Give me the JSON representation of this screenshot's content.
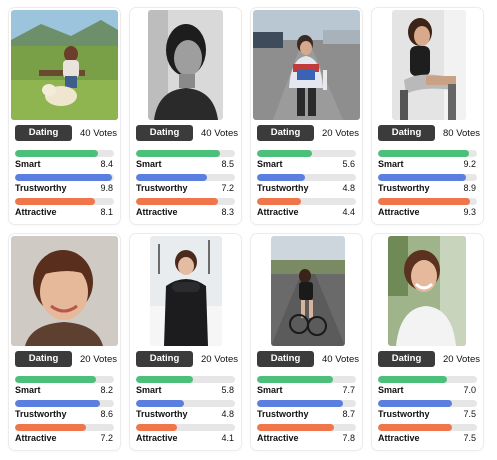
{
  "colors": {
    "smart": "#4cc07a",
    "trustworthy": "#5b7fe0",
    "attractive": "#f0754a",
    "tag_bg": "#3b3b3b"
  },
  "metric_labels": {
    "smart": "Smart",
    "trustworthy": "Trustworthy",
    "attractive": "Attractive"
  },
  "cards": [
    {
      "tag": "Dating",
      "votes": "40 Votes",
      "photo": "outdoor-with-dog",
      "smart": {
        "value": "8.4",
        "level": 0.84
      },
      "trustworthy": {
        "value": "9.8",
        "level": 0.98
      },
      "attractive": {
        "value": "8.1",
        "level": 0.81
      }
    },
    {
      "tag": "Dating",
      "votes": "40 Votes",
      "photo": "black-and-white-portrait",
      "smart": {
        "value": "8.5",
        "level": 0.85
      },
      "trustworthy": {
        "value": "7.2",
        "level": 0.72
      },
      "attractive": {
        "value": "8.3",
        "level": 0.83
      }
    },
    {
      "tag": "Dating",
      "votes": "20 Votes",
      "photo": "street-jacket",
      "smart": {
        "value": "5.6",
        "level": 0.56
      },
      "trustworthy": {
        "value": "4.8",
        "level": 0.48
      },
      "attractive": {
        "value": "4.4",
        "level": 0.44
      }
    },
    {
      "tag": "Dating",
      "votes": "80 Votes",
      "photo": "seated-studio",
      "smart": {
        "value": "9.2",
        "level": 0.92
      },
      "trustworthy": {
        "value": "8.9",
        "level": 0.89
      },
      "attractive": {
        "value": "9.3",
        "level": 0.93
      }
    },
    {
      "tag": "Dating",
      "votes": "20 Votes",
      "photo": "smiling-headshot",
      "smart": {
        "value": "8.2",
        "level": 0.82
      },
      "trustworthy": {
        "value": "8.6",
        "level": 0.86
      },
      "attractive": {
        "value": "7.2",
        "level": 0.72
      }
    },
    {
      "tag": "Dating",
      "votes": "20 Votes",
      "photo": "winter-coat",
      "smart": {
        "value": "5.8",
        "level": 0.58
      },
      "trustworthy": {
        "value": "4.8",
        "level": 0.48
      },
      "attractive": {
        "value": "4.1",
        "level": 0.41
      }
    },
    {
      "tag": "Dating",
      "votes": "40 Votes",
      "photo": "cycling-road",
      "smart": {
        "value": "7.7",
        "level": 0.77
      },
      "trustworthy": {
        "value": "8.7",
        "level": 0.87
      },
      "attractive": {
        "value": "7.8",
        "level": 0.78
      }
    },
    {
      "tag": "Dating",
      "votes": "20 Votes",
      "photo": "laughing-outdoors",
      "smart": {
        "value": "7.0",
        "level": 0.7
      },
      "trustworthy": {
        "value": "7.5",
        "level": 0.75
      },
      "attractive": {
        "value": "7.5",
        "level": 0.75
      }
    }
  ]
}
